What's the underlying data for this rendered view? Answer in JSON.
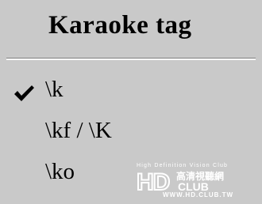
{
  "menu": {
    "title": "Karaoke tag",
    "items": [
      {
        "label": "\\k",
        "checked": true
      },
      {
        "label": "\\kf / \\K",
        "checked": false
      },
      {
        "label": "\\ko",
        "checked": false
      }
    ]
  },
  "watermark": {
    "tagline": "High Definition Vision Club",
    "logo_text": "HDCLUB",
    "logo_chinese": "高清視聽網",
    "url": "WWW.HD.CLUB.TW"
  },
  "colors": {
    "menu_background": "#c9c9c9",
    "separator_dark": "#7f7f7f",
    "separator_light": "#ffffff",
    "text": "#000000",
    "watermark": "#ffffff"
  }
}
